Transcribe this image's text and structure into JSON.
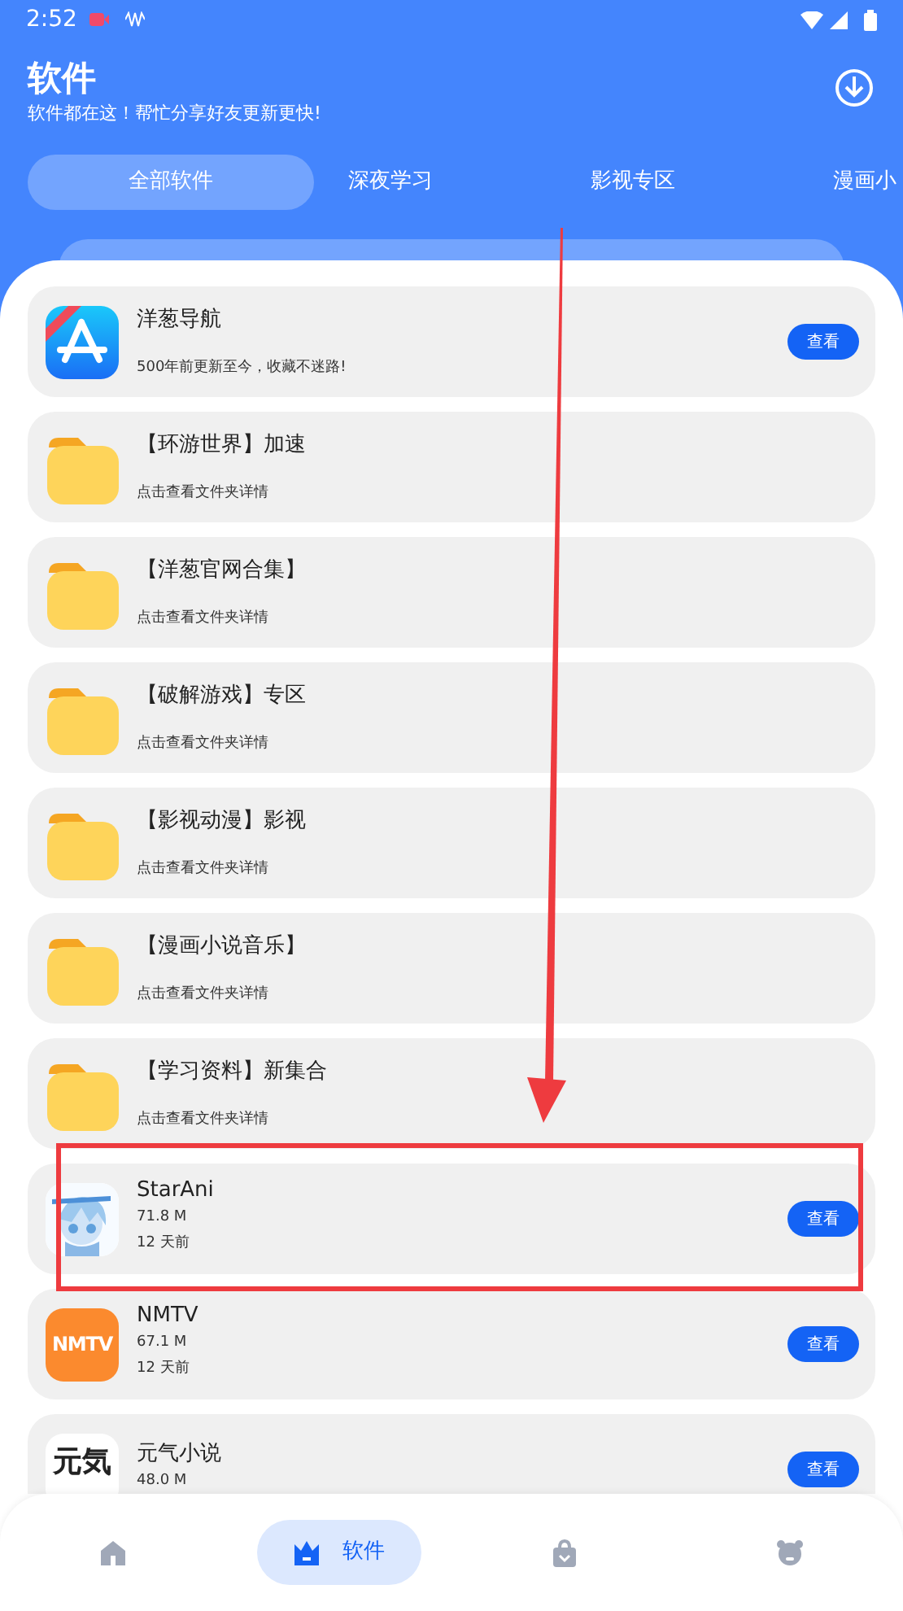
{
  "status_bar": {
    "time": "2:52"
  },
  "header": {
    "title": "软件",
    "subtitle": "软件都在这！帮忙分享好友更新更快!"
  },
  "tabs": [
    {
      "label": "全部软件",
      "selected": true
    },
    {
      "label": "深夜学习",
      "selected": false
    },
    {
      "label": "影视专区",
      "selected": false
    },
    {
      "label": "漫画小",
      "selected": false
    }
  ],
  "items": [
    {
      "kind": "link",
      "title": "洋葱导航",
      "subtitle": "500年前更新至今，收藏不迷路!",
      "button": "查看"
    },
    {
      "kind": "folder",
      "title": "【环游世界】加速",
      "subtitle": "点击查看文件夹详情"
    },
    {
      "kind": "folder",
      "title": "【洋葱官网合集】",
      "subtitle": "点击查看文件夹详情"
    },
    {
      "kind": "folder",
      "title": "【破解游戏】专区",
      "subtitle": "点击查看文件夹详情"
    },
    {
      "kind": "folder",
      "title": "【影视动漫】影视",
      "subtitle": "点击查看文件夹详情"
    },
    {
      "kind": "folder",
      "title": "【漫画小说音乐】",
      "subtitle": "点击查看文件夹详情"
    },
    {
      "kind": "folder",
      "title": "【学习资料】新集合",
      "subtitle": "点击查看文件夹详情"
    },
    {
      "kind": "app",
      "title": "StarAni",
      "size": "71.8 M",
      "age": "12 天前",
      "button": "查看"
    },
    {
      "kind": "badge",
      "logo_text": "NMTV",
      "title": "NMTV",
      "size": "67.1 M",
      "age": "12 天前",
      "button": "查看"
    },
    {
      "kind": "wordmark",
      "logo_text": "元気",
      "title": "元气小说",
      "size": "48.0 M",
      "button": "查看"
    }
  ],
  "bottom_nav": [
    {
      "selected": false
    },
    {
      "label": "软件",
      "selected": true
    },
    {
      "selected": false
    },
    {
      "selected": false
    }
  ]
}
